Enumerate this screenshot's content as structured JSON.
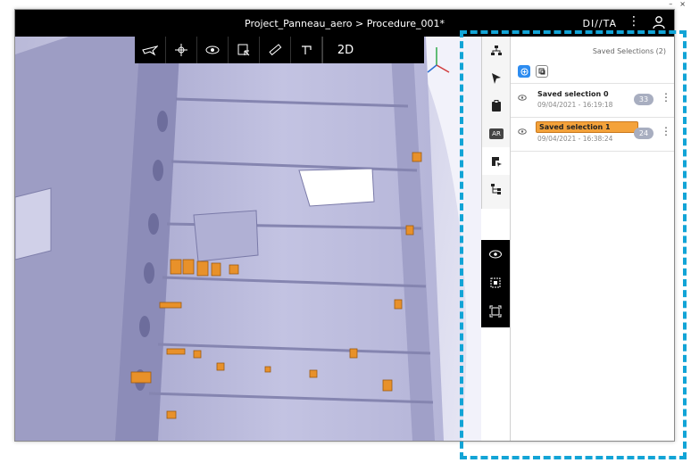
{
  "window": {
    "minimize": "–",
    "close": "×"
  },
  "titlebar": {
    "title": "Project_Panneau_aero > Procedure_001*",
    "logo": "DI//TA",
    "menu": "⋮"
  },
  "toolbar": {
    "tools": [
      {
        "name": "fly-mode",
        "glyph": "✈"
      },
      {
        "name": "orbit",
        "glyph": "✢"
      },
      {
        "name": "visibility",
        "glyph": "◉"
      },
      {
        "name": "save-view",
        "glyph": "⎘"
      },
      {
        "name": "measure",
        "glyph": "📐"
      },
      {
        "name": "section",
        "glyph": "⌐"
      }
    ],
    "mode_2d": "2D"
  },
  "rail": {
    "ar": "AR"
  },
  "panel": {
    "title": "Saved Selections (2)",
    "selections": [
      {
        "name": "Saved selection 0",
        "date": "09/04/2021 - 16:19:18",
        "count": "33",
        "highlighted": false
      },
      {
        "name": "Saved selection 1",
        "date": "09/04/2021 - 16:38:24",
        "count": "24",
        "highlighted": true
      }
    ]
  },
  "colors": {
    "accent_blue": "#2d8cf0",
    "highlight_orange": "#f4a23a",
    "frame_cyan": "#12a4d6",
    "model_lavender": "#c6c6e2",
    "parts_orange": "#e8912a"
  }
}
